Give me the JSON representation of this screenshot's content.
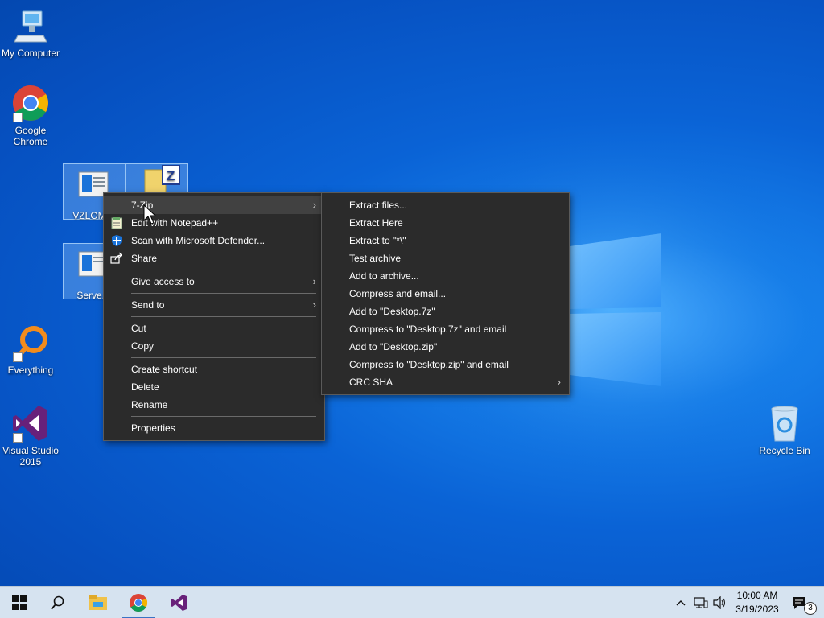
{
  "desktop": {
    "icons": [
      {
        "label": "My Computer"
      },
      {
        "label": "Google Chrome"
      },
      {
        "label": "VZLOM..."
      },
      {
        "label": "Serve..."
      },
      {
        "label": "Everything"
      },
      {
        "label": "Visual Studio 2015"
      },
      {
        "label": "Recycle Bin"
      }
    ]
  },
  "context_menu": {
    "items": [
      {
        "label": "7-Zip"
      },
      {
        "label": "Edit with Notepad++"
      },
      {
        "label": "Scan with Microsoft Defender..."
      },
      {
        "label": "Share"
      },
      {
        "label": "Give access to"
      },
      {
        "label": "Send to"
      },
      {
        "label": "Cut"
      },
      {
        "label": "Copy"
      },
      {
        "label": "Create shortcut"
      },
      {
        "label": "Delete"
      },
      {
        "label": "Rename"
      },
      {
        "label": "Properties"
      }
    ]
  },
  "submenu_7zip": {
    "items": [
      {
        "label": "Extract files..."
      },
      {
        "label": "Extract Here"
      },
      {
        "label": "Extract to \"*\\\""
      },
      {
        "label": "Test archive"
      },
      {
        "label": "Add to archive..."
      },
      {
        "label": "Compress and email..."
      },
      {
        "label": "Add to \"Desktop.7z\""
      },
      {
        "label": "Compress to \"Desktop.7z\" and email"
      },
      {
        "label": "Add to \"Desktop.zip\""
      },
      {
        "label": "Compress to \"Desktop.zip\" and email"
      },
      {
        "label": "CRC SHA"
      }
    ]
  },
  "taskbar": {
    "time": "10:00 AM",
    "date": "3/19/2023",
    "notification_count": "3",
    "pinned": [
      "windows-start-icon",
      "search-icon",
      "file-explorer-icon",
      "chrome-icon",
      "visual-studio-icon"
    ]
  },
  "colors": {
    "menu_bg": "#2b2b2b",
    "menu_highlight": "#414141",
    "desktop_blue": "#0a63d6",
    "taskbar_bg": "#d6e3f0"
  }
}
